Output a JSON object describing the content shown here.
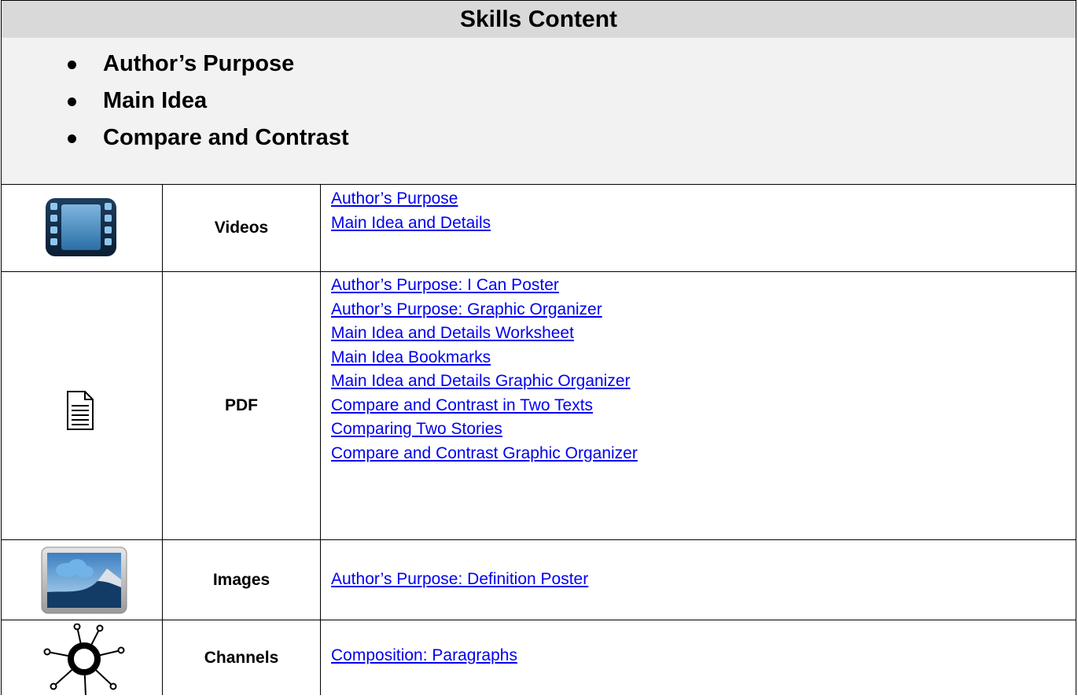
{
  "title": "Skills Content",
  "skills": [
    "Author’s Purpose",
    "Main Idea",
    "Compare and Contrast"
  ],
  "rows": [
    {
      "icon": "film-strip-icon",
      "type": "Videos",
      "links": [
        "Author’s Purpose",
        "Main Idea and Details"
      ]
    },
    {
      "icon": "document-icon",
      "type": "PDF",
      "links": [
        "Author’s Purpose: I Can Poster",
        "Author’s Purpose: Graphic Organizer",
        "Main Idea and Details Worksheet",
        "Main Idea Bookmarks",
        "Main Idea and Details Graphic Organizer",
        "Compare and Contrast in Two Texts",
        "Comparing Two Stories",
        "Compare and Contrast Graphic Organizer"
      ]
    },
    {
      "icon": "image-icon",
      "type": "Images",
      "links": [
        "Author’s Purpose: Definition Poster"
      ]
    },
    {
      "icon": "channels-hub-icon",
      "type": "Channels",
      "links": [
        "Composition: Paragraphs"
      ]
    }
  ],
  "colors": {
    "link": "#0000ee",
    "header_bg": "#d9d9d9",
    "skills_bg": "#f2f2f2"
  }
}
